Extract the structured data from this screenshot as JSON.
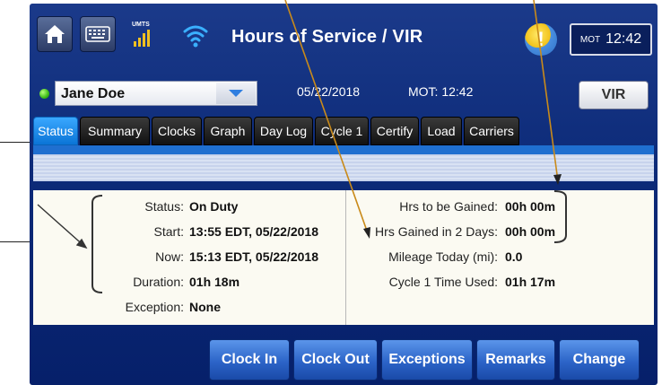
{
  "header": {
    "title": "Hours of Service / VIR",
    "signal_label": "UMTS",
    "mot_label": "MOT",
    "mot_time": "12:42",
    "alert_glyph": "!"
  },
  "driver": {
    "name": "Jane Doe",
    "date": "05/22/2018",
    "mot": "MOT: 12:42",
    "vir_label": "VIR",
    "status_color": "#3cbb17"
  },
  "tabs": [
    {
      "label": "Status",
      "active": true
    },
    {
      "label": "Summary"
    },
    {
      "label": "Clocks"
    },
    {
      "label": "Graph"
    },
    {
      "label": "Day Log"
    },
    {
      "label": "Cycle 1"
    },
    {
      "label": "Certify"
    },
    {
      "label": "Load"
    },
    {
      "label": "Carriers"
    }
  ],
  "left_fields": [
    {
      "key": "Status:",
      "value": "On Duty"
    },
    {
      "key": "Start:",
      "value": "13:55 EDT, 05/22/2018"
    },
    {
      "key": "Now:",
      "value": "15:13 EDT, 05/22/2018"
    },
    {
      "key": "Duration:",
      "value": "01h 18m"
    },
    {
      "key": "Exception:",
      "value": "None"
    }
  ],
  "right_fields": [
    {
      "key": "Hrs to be Gained:",
      "value": "00h 00m"
    },
    {
      "key": "Hrs Gained in 2 Days:",
      "value": "00h 00m"
    },
    {
      "key": "Mileage Today (mi):",
      "value": "0.0"
    },
    {
      "key": "Cycle 1 Time Used:",
      "value": "01h 17m"
    }
  ],
  "buttons": {
    "clock_in": "Clock In",
    "clock_out": "Clock Out",
    "exceptions": "Exceptions",
    "remarks": "Remarks",
    "change": "Change"
  },
  "colors": {
    "accent": "#1f6fd0",
    "active_tab": "#0a74d6",
    "background": "#0c2a78"
  }
}
